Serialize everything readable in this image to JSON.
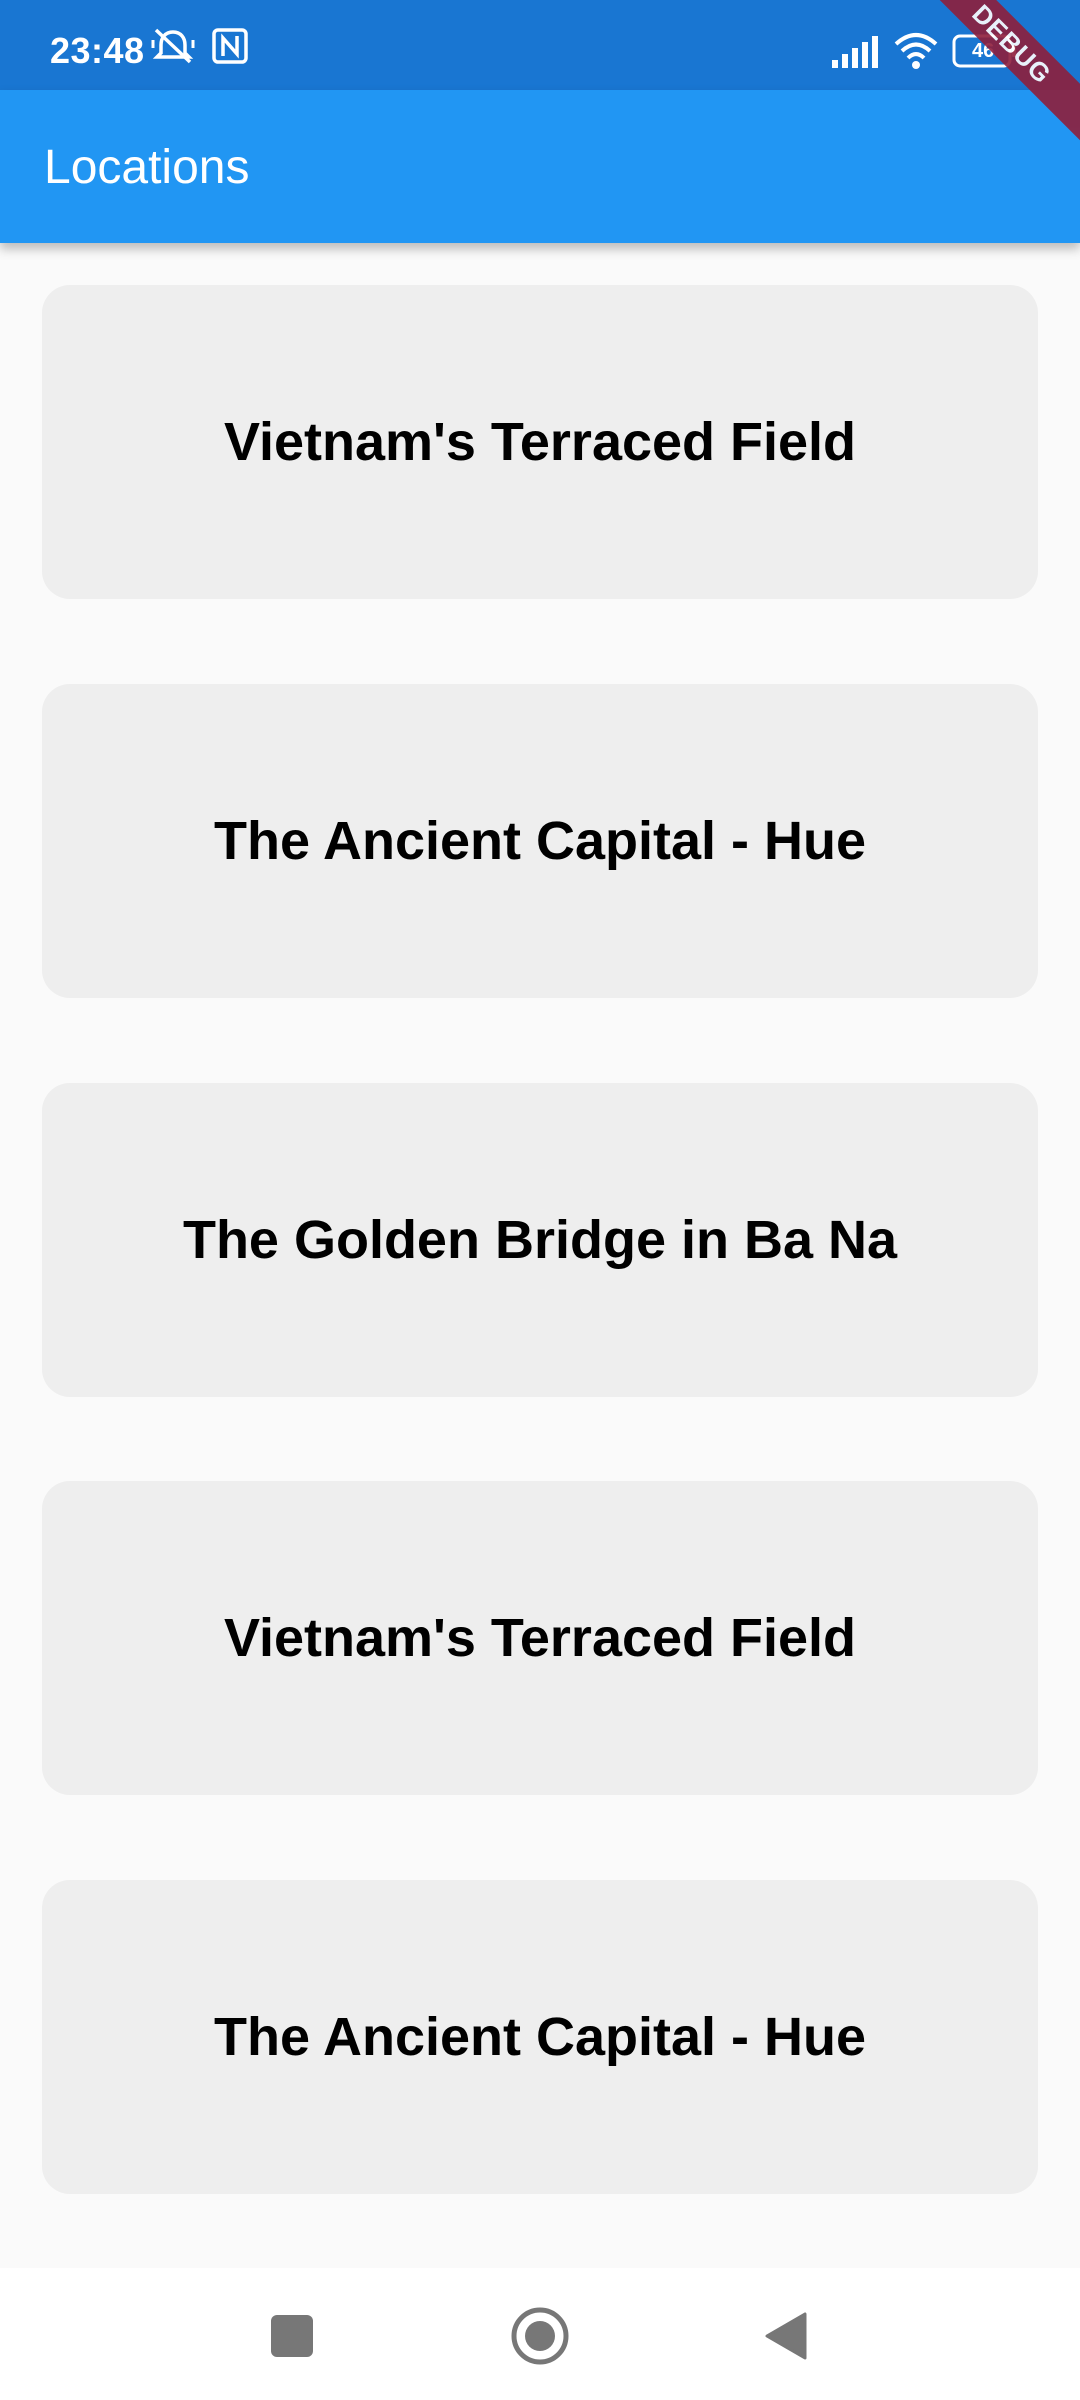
{
  "status_bar": {
    "time": "23:48",
    "battery_level": "46",
    "icons": [
      "mute-icon",
      "nfc-icon",
      "signal-icon",
      "wifi-icon",
      "battery-icon"
    ],
    "background": "#1976d2"
  },
  "app_bar": {
    "title": "Locations",
    "background": "#2196f3"
  },
  "debug_banner": {
    "label": "DEBUG",
    "color": "#8e1f3c"
  },
  "locations": [
    {
      "title": "Vietnam's Terraced Field"
    },
    {
      "title": "The Ancient Capital - Hue"
    },
    {
      "title": "The Golden Bridge in Ba Na"
    },
    {
      "title": "Vietnam's Terraced Field"
    },
    {
      "title": "The Ancient Capital - Hue"
    }
  ],
  "nav_bar": {
    "buttons": [
      "recents-icon",
      "home-icon",
      "back-icon"
    ]
  }
}
